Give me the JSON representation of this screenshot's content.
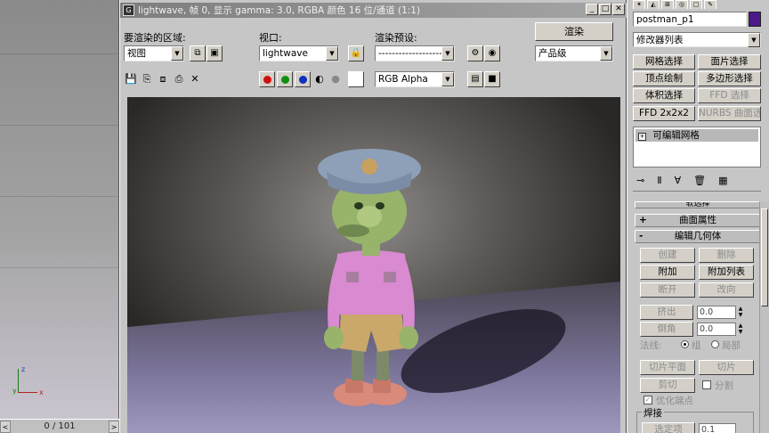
{
  "render_window": {
    "title": "lightwave, 帧 0, 显示 gamma: 3.0, RGBA 颜色 16 位/通道 (1:1)",
    "area_label": "要渲染的区域:",
    "area_value": "视图",
    "viewport_label": "视口:",
    "viewport_value": "lightwave",
    "preset_label": "渲染预设:",
    "preset_value": "--------------------",
    "render_button": "渲染",
    "quality_value": "产品级",
    "channel_value": "RGB Alpha",
    "minimize_glyph": "_",
    "maximize_glyph": "□",
    "close_glyph": "✕",
    "colors": {
      "red": "#d01010",
      "green": "#109010",
      "blue": "#1030c0"
    }
  },
  "timeline": {
    "position": "0 / 101",
    "prev": "<",
    "next": ">"
  },
  "axis": {
    "z": "z",
    "y": "y",
    "x": "x"
  },
  "command_panel": {
    "object_name": "postman_p1",
    "object_color": "#4a1a8a",
    "modifier_list": "修改器列表",
    "buttons": {
      "mesh_select": "网格选择",
      "patch_select": "面片选择",
      "vertex_paint": "顶点绘制",
      "poly_select": "多边形选择",
      "vol_select": "体积选择",
      "ffd_select": "FFD 选择",
      "ffd_2x2x2": "FFD 2x2x2",
      "nurbs_surf_select": "NURBS 曲面选择"
    },
    "stack_item": "可编辑网格",
    "rollouts": {
      "surface_props": "曲面属性",
      "edit_geometry": "编辑几何体",
      "selection_cut": "软选择"
    },
    "edit": {
      "create": "创建",
      "delete": "删除",
      "attach": "附加",
      "attach_list": "附加列表",
      "break": "断开",
      "turn": "改向",
      "extrude": "挤出",
      "extrude_val": "0.0",
      "chamfer": "倒角",
      "chamfer_val": "0.0",
      "normals": "法线:",
      "group": "组",
      "local": "局部",
      "slice_plane": "切片平面",
      "slice": "切片",
      "cut": "剪切",
      "split": "分割",
      "refine_ends": "优化端点",
      "weld": "焊接",
      "selected": "选定项",
      "selected_val": "0.1"
    }
  }
}
